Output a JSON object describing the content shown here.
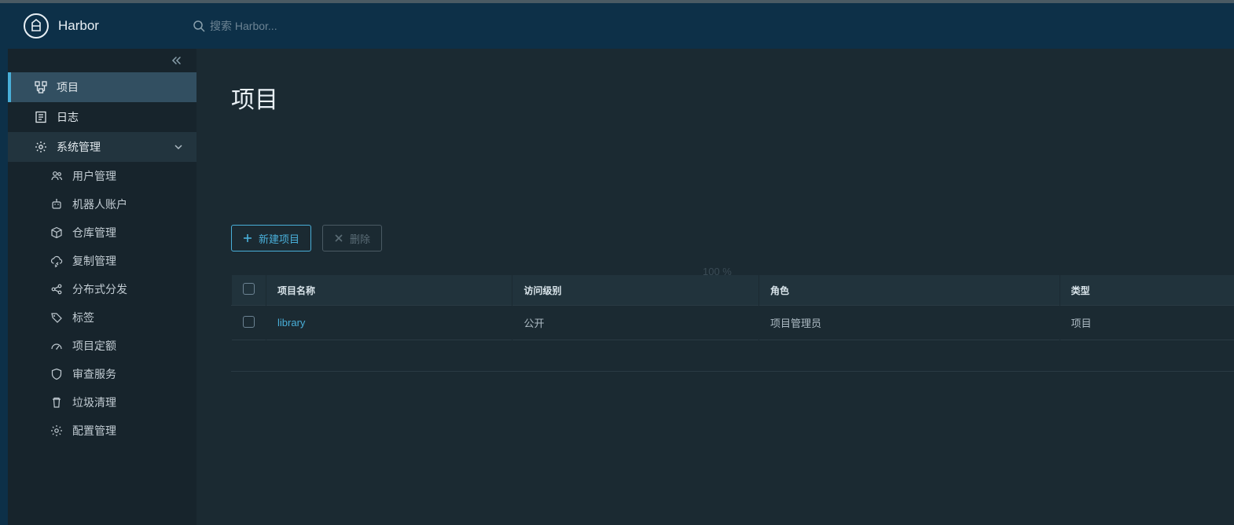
{
  "header": {
    "brand": "Harbor",
    "search_placeholder": "搜索 Harbor..."
  },
  "sidebar": {
    "items": [
      {
        "label": "项目"
      },
      {
        "label": "日志"
      }
    ],
    "section_label": "系统管理",
    "subitems": [
      {
        "label": "用户管理"
      },
      {
        "label": "机器人账户"
      },
      {
        "label": "仓库管理"
      },
      {
        "label": "复制管理"
      },
      {
        "label": "分布式分发"
      },
      {
        "label": "标签"
      },
      {
        "label": "项目定额"
      },
      {
        "label": "审查服务"
      },
      {
        "label": "垃圾清理"
      },
      {
        "label": "配置管理"
      }
    ]
  },
  "page": {
    "title": "项目"
  },
  "actions": {
    "new_project": "新建项目",
    "delete": "删除"
  },
  "table": {
    "headers": [
      "项目名称",
      "访问级别",
      "角色",
      "类型"
    ],
    "rows": [
      {
        "name": "library",
        "access": "公开",
        "role": "项目管理员",
        "type": "项目"
      }
    ]
  },
  "ghost_text": "100 %"
}
